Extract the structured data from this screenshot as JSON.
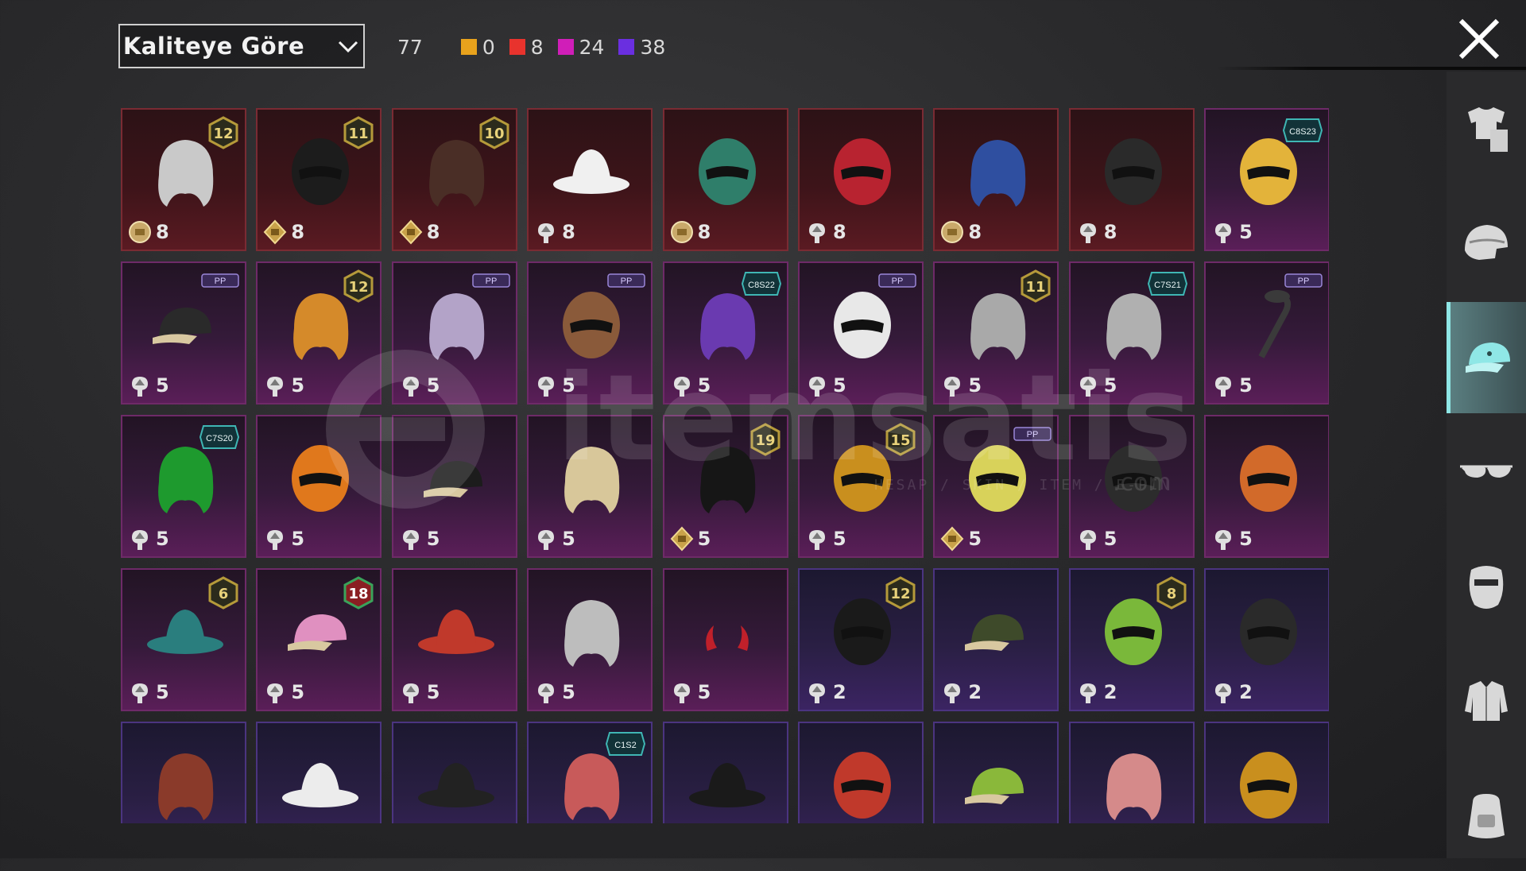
{
  "sort": {
    "label": "Kaliteye Göre",
    "icon": "chevron-down-icon"
  },
  "counts": {
    "total": "77",
    "tiers": [
      {
        "name": "legendary-gold",
        "value": "0",
        "color": "#e8a21c"
      },
      {
        "name": "mythic-red",
        "value": "8",
        "color": "#e8332d"
      },
      {
        "name": "epic-pink",
        "value": "24",
        "color": "#d01eb8"
      },
      {
        "name": "rare-purple",
        "value": "38",
        "color": "#6a2fe0"
      }
    ]
  },
  "close": {
    "icon": "close-icon"
  },
  "sidenav": [
    {
      "name": "outfits",
      "icon": "shirt-pants-icon",
      "active": false
    },
    {
      "name": "helmets",
      "icon": "helmet-icon",
      "active": false
    },
    {
      "name": "hats",
      "icon": "cap-icon",
      "active": true
    },
    {
      "name": "glasses",
      "icon": "glasses-icon",
      "active": false
    },
    {
      "name": "masks",
      "icon": "mask-icon",
      "active": false
    },
    {
      "name": "jackets",
      "icon": "jacket-icon",
      "active": false
    },
    {
      "name": "backpacks",
      "icon": "backpack-icon",
      "active": false
    }
  ],
  "items": [
    {
      "tier": "red",
      "art": "white-hair-icon",
      "artColor": "#c9c9c9",
      "badge": "12",
      "badgeType": "level",
      "currency": "ag-coin",
      "price": "8"
    },
    {
      "tier": "red",
      "art": "black-helmet-icon",
      "artColor": "#1c1c1c",
      "badge": "11",
      "badgeType": "level",
      "currency": "bp-coin",
      "price": "8"
    },
    {
      "tier": "red",
      "art": "dark-hair-icon",
      "artColor": "#4a2e26",
      "badge": "10",
      "badgeType": "level",
      "currency": "bp-coin",
      "price": "8"
    },
    {
      "tier": "red",
      "art": "cowboy-hat-icon",
      "artColor": "#f0f0f0",
      "badge": "",
      "badgeType": "",
      "currency": "ticket",
      "price": "8"
    },
    {
      "tier": "red",
      "art": "dragon-helmet-icon",
      "artColor": "#2f7e6a",
      "badge": "",
      "badgeType": "",
      "currency": "ag-coin",
      "price": "8"
    },
    {
      "tier": "red",
      "art": "demon-mask-icon",
      "artColor": "#b82330",
      "badge": "",
      "badgeType": "",
      "currency": "ticket",
      "price": "8"
    },
    {
      "tier": "red",
      "art": "blue-hair-icon",
      "artColor": "#2f4fa0",
      "badge": "",
      "badgeType": "",
      "currency": "ag-coin",
      "price": "8"
    },
    {
      "tier": "red",
      "art": "gold-visor-helmet-icon",
      "artColor": "#2a2a2a",
      "badge": "",
      "badgeType": "",
      "currency": "ticket",
      "price": "8"
    },
    {
      "tier": "pink",
      "art": "cat-headphones-icon",
      "artColor": "#e3b33a",
      "badge": "C8S23",
      "badgeType": "season",
      "currency": "ticket",
      "price": "5"
    },
    {
      "tier": "pink",
      "art": "cap-goggles-icon",
      "artColor": "#2a2a2a",
      "badge": "PP",
      "badgeType": "event",
      "currency": "ticket",
      "price": "5"
    },
    {
      "tier": "pink",
      "art": "orange-hair-icon",
      "artColor": "#d58a2a",
      "badge": "12",
      "badgeType": "level",
      "currency": "ticket",
      "price": "5"
    },
    {
      "tier": "pink",
      "art": "lilac-hair-icon",
      "artColor": "#b3a3c8",
      "badge": "PP",
      "badgeType": "event",
      "currency": "ticket",
      "price": "5"
    },
    {
      "tier": "pink",
      "art": "bear-mask-icon",
      "artColor": "#8a5a3a",
      "badge": "PP",
      "badgeType": "event",
      "currency": "ticket",
      "price": "5"
    },
    {
      "tier": "pink",
      "art": "purple-hair-icon",
      "artColor": "#6a3ab0",
      "badge": "C8S22",
      "badgeType": "season",
      "currency": "ticket",
      "price": "5"
    },
    {
      "tier": "pink",
      "art": "panda-head-icon",
      "artColor": "#e8e8e8",
      "badge": "PP",
      "badgeType": "event",
      "currency": "ticket",
      "price": "5"
    },
    {
      "tier": "pink",
      "art": "flower-crown-icon",
      "artColor": "#a9a9a9",
      "badge": "11",
      "badgeType": "level",
      "currency": "ticket",
      "price": "5"
    },
    {
      "tier": "pink",
      "art": "silver-hair-icon",
      "artColor": "#b0b0b0",
      "badge": "C7S21",
      "badgeType": "season",
      "currency": "ticket",
      "price": "5"
    },
    {
      "tier": "pink",
      "art": "braid-icon",
      "artColor": "#3a3a3a",
      "badge": "PP",
      "badgeType": "event",
      "currency": "ticket",
      "price": "5"
    },
    {
      "tier": "pink",
      "art": "green-hair-icon",
      "artColor": "#1e9a2e",
      "badge": "C7S20",
      "badgeType": "season",
      "currency": "ticket",
      "price": "5"
    },
    {
      "tier": "pink",
      "art": "pumpkin-head-icon",
      "artColor": "#e0781c",
      "badge": "",
      "badgeType": "",
      "currency": "ticket",
      "price": "5"
    },
    {
      "tier": "pink",
      "art": "officer-cap-icon",
      "artColor": "#1c1c1c",
      "badge": "",
      "badgeType": "",
      "currency": "ticket",
      "price": "5"
    },
    {
      "tier": "pink",
      "art": "blonde-curls-icon",
      "artColor": "#d8c79a",
      "badge": "",
      "badgeType": "",
      "currency": "ticket",
      "price": "5"
    },
    {
      "tier": "pink",
      "art": "black-bun-hair-icon",
      "artColor": "#161616",
      "badge": "19",
      "badgeType": "level",
      "currency": "bp-coin",
      "price": "5"
    },
    {
      "tier": "pink",
      "art": "gold-helmet-icon",
      "artColor": "#c98f1e",
      "badge": "15",
      "badgeType": "level",
      "currency": "ticket",
      "price": "5"
    },
    {
      "tier": "pink",
      "art": "visor-helmet-icon",
      "artColor": "#d8d25a",
      "badge": "PP",
      "badgeType": "event",
      "currency": "bp-coin",
      "price": "5"
    },
    {
      "tier": "pink",
      "art": "tactical-helmet-icon",
      "artColor": "#2c2c2c",
      "badge": "",
      "badgeType": "",
      "currency": "ticket",
      "price": "5"
    },
    {
      "tier": "pink",
      "art": "samurai-helmet-icon",
      "artColor": "#d26a2a",
      "badge": "",
      "badgeType": "",
      "currency": "ticket",
      "price": "5"
    },
    {
      "tier": "pink",
      "art": "tree-hat-icon",
      "artColor": "#2a7e7e",
      "badge": "6",
      "badgeType": "level",
      "currency": "ticket",
      "price": "5"
    },
    {
      "tier": "pink",
      "art": "pink-cap-icon",
      "artColor": "#e090c0",
      "badge": "18",
      "badgeType": "level-red",
      "currency": "ticket",
      "price": "5"
    },
    {
      "tier": "pink",
      "art": "guard-hat-icon",
      "artColor": "#c0392b",
      "badge": "",
      "badgeType": "",
      "currency": "ticket",
      "price": "5"
    },
    {
      "tier": "pink",
      "art": "goggles-hair-icon",
      "artColor": "#bdbdbd",
      "badge": "",
      "badgeType": "",
      "currency": "ticket",
      "price": "5"
    },
    {
      "tier": "pink",
      "art": "devil-horns-icon",
      "artColor": "#c0202a",
      "badge": "",
      "badgeType": "",
      "currency": "ticket",
      "price": "5"
    },
    {
      "tier": "purple",
      "art": "bunny-helmet-icon",
      "artColor": "#1a1a1a",
      "badge": "12",
      "badgeType": "level",
      "currency": "ticket",
      "price": "2"
    },
    {
      "tier": "purple",
      "art": "military-cap-icon",
      "artColor": "#3e4a2a",
      "badge": "",
      "badgeType": "",
      "currency": "ticket",
      "price": "2"
    },
    {
      "tier": "purple",
      "art": "skull-hood-icon",
      "artColor": "#7ab83a",
      "badge": "8",
      "badgeType": "level",
      "currency": "ticket",
      "price": "2"
    },
    {
      "tier": "purple",
      "art": "gasmask-helmet-icon",
      "artColor": "#2a2a2a",
      "badge": "",
      "badgeType": "",
      "currency": "ticket",
      "price": "2"
    },
    {
      "tier": "purple",
      "art": "aviator-hair-icon",
      "artColor": "#8a3a2a",
      "badge": "",
      "badgeType": "",
      "currency": "",
      "price": ""
    },
    {
      "tier": "purple",
      "art": "sun-hat-icon",
      "artColor": "#ececec",
      "badge": "",
      "badgeType": "",
      "currency": "",
      "price": ""
    },
    {
      "tier": "purple",
      "art": "bucket-hat-icon",
      "artColor": "#222222",
      "badge": "",
      "badgeType": "",
      "currency": "",
      "price": ""
    },
    {
      "tier": "purple",
      "art": "beanie-icon",
      "artColor": "#c85a5a",
      "badge": "C1S2",
      "badgeType": "season",
      "currency": "",
      "price": ""
    },
    {
      "tier": "purple",
      "art": "witch-hat-icon",
      "artColor": "#1a1a1a",
      "badge": "",
      "badgeType": "",
      "currency": "",
      "price": ""
    },
    {
      "tier": "purple",
      "art": "racing-helmet-icon",
      "artColor": "#c0392b",
      "badge": "",
      "badgeType": "",
      "currency": "",
      "price": ""
    },
    {
      "tier": "purple",
      "art": "green-cap-icon",
      "artColor": "#8ab83a",
      "badge": "",
      "badgeType": "",
      "currency": "",
      "price": ""
    },
    {
      "tier": "purple",
      "art": "pink-hair-icon",
      "artColor": "#d58a8a",
      "badge": "",
      "badgeType": "",
      "currency": "",
      "price": ""
    },
    {
      "tier": "purple",
      "art": "ponytail-helmet-icon",
      "artColor": "#c98f1e",
      "badge": "",
      "badgeType": "",
      "currency": "",
      "price": ""
    }
  ],
  "watermark": {
    "text": "itemsatis",
    "sub": "HESAP / SKIN / ITEM / E-PIN",
    "suffix": ".com"
  }
}
